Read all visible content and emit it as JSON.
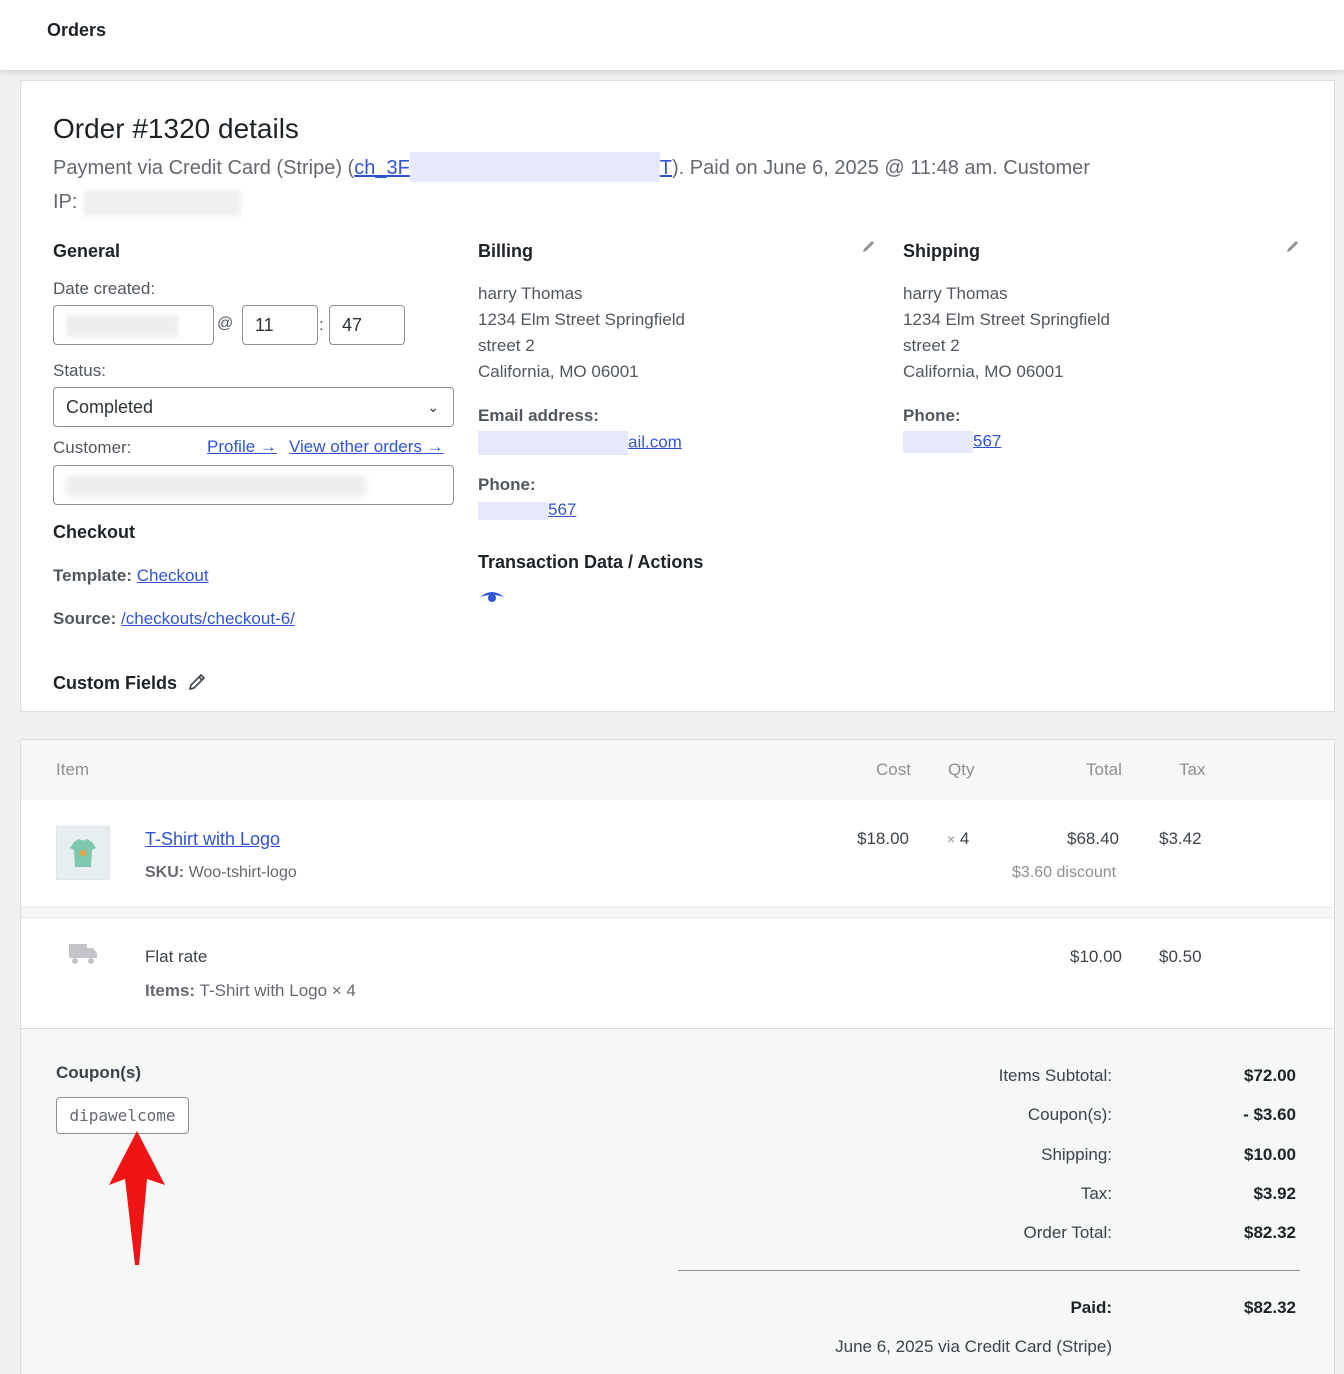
{
  "header": {
    "title": "Orders"
  },
  "order": {
    "title": "Order #1320 details",
    "payment_prefix": "Payment via Credit Card (Stripe) (",
    "charge_id_start": "ch_3F",
    "charge_id_end": "T",
    "payment_suffix": "). Paid on June 6, 2025 @ 11:48 am. Customer",
    "ip_label": "IP:"
  },
  "general": {
    "heading": "General",
    "date_label": "Date created:",
    "at": "@",
    "colon": ":",
    "hour": "11",
    "minute": "47",
    "status_label": "Status:",
    "status_value": "Completed",
    "customer_label": "Customer:",
    "profile_link": "Profile →",
    "other_orders_link": "View other orders →"
  },
  "checkout": {
    "heading": "Checkout",
    "template_label": "Template:",
    "template_value": "Checkout",
    "source_label": "Source:",
    "source_value": "/checkouts/checkout-6/"
  },
  "custom_fields": {
    "heading": "Custom Fields"
  },
  "billing": {
    "heading": "Billing",
    "name": "harry Thomas",
    "line1": "1234 Elm Street Springfield",
    "line2": "street 2",
    "line3": "California, MO 06001",
    "email_label": "Email address:",
    "email_visible": "ail.com",
    "phone_label": "Phone:",
    "phone_visible": "567",
    "transaction_heading": "Transaction Data / Actions"
  },
  "shipping": {
    "heading": "Shipping",
    "name": "harry Thomas",
    "line1": "1234 Elm Street Springfield",
    "line2": "street 2",
    "line3": "California, MO 06001",
    "phone_label": "Phone:",
    "phone_visible": "567"
  },
  "items_table": {
    "columns": {
      "item": "Item",
      "cost": "Cost",
      "qty": "Qty",
      "total": "Total",
      "tax": "Tax"
    },
    "product": {
      "name": "T-Shirt with Logo",
      "sku_label": "SKU:",
      "sku": "Woo-tshirt-logo",
      "cost": "$18.00",
      "qty_x": "×",
      "qty": "4",
      "total": "$68.40",
      "discount": "$3.60 discount",
      "tax": "$3.42"
    },
    "shipping_line": {
      "name": "Flat rate",
      "items_label": "Items:",
      "items": "T-Shirt with Logo × 4",
      "total": "$10.00",
      "tax": "$0.50"
    }
  },
  "totals": {
    "coupons_heading": "Coupon(s)",
    "coupon_code": "dipawelcome",
    "items_subtotal_label": "Items Subtotal:",
    "items_subtotal": "$72.00",
    "coupon_label": "Coupon(s):",
    "coupon_value": "- $3.60",
    "shipping_label": "Shipping:",
    "shipping_value": "$10.00",
    "tax_label": "Tax:",
    "tax_value": "$3.92",
    "order_total_label": "Order Total:",
    "order_total": "$82.32",
    "paid_label": "Paid:",
    "paid_value": "$82.32",
    "paid_note": "June 6, 2025 via Credit Card (Stripe)"
  },
  "colors": {
    "link": "#2f55d4",
    "annotation_arrow": "#f01414"
  }
}
